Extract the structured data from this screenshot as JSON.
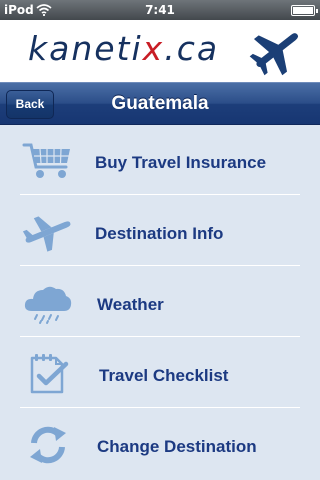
{
  "status_bar": {
    "carrier": "iPod",
    "time": "7:41"
  },
  "brand": {
    "logo_prefix": "kaneti",
    "logo_accent": "x",
    "logo_suffix": ".ca",
    "plane_icon": "airplane-icon",
    "logo_color": "#16315f",
    "accent_color": "#c81d25"
  },
  "navbar": {
    "back_label": "Back",
    "title": "Guatemala"
  },
  "menu": {
    "items": [
      {
        "label": "Buy Travel Insurance",
        "icon": "shopping-cart-icon"
      },
      {
        "label": "Destination Info",
        "icon": "airplane-icon"
      },
      {
        "label": "Weather",
        "icon": "rain-cloud-icon"
      },
      {
        "label": "Travel Checklist",
        "icon": "checklist-icon"
      },
      {
        "label": "Change Destination",
        "icon": "refresh-icon"
      }
    ],
    "icon_color": "#7ea6d3",
    "label_color": "#1c3a82"
  }
}
